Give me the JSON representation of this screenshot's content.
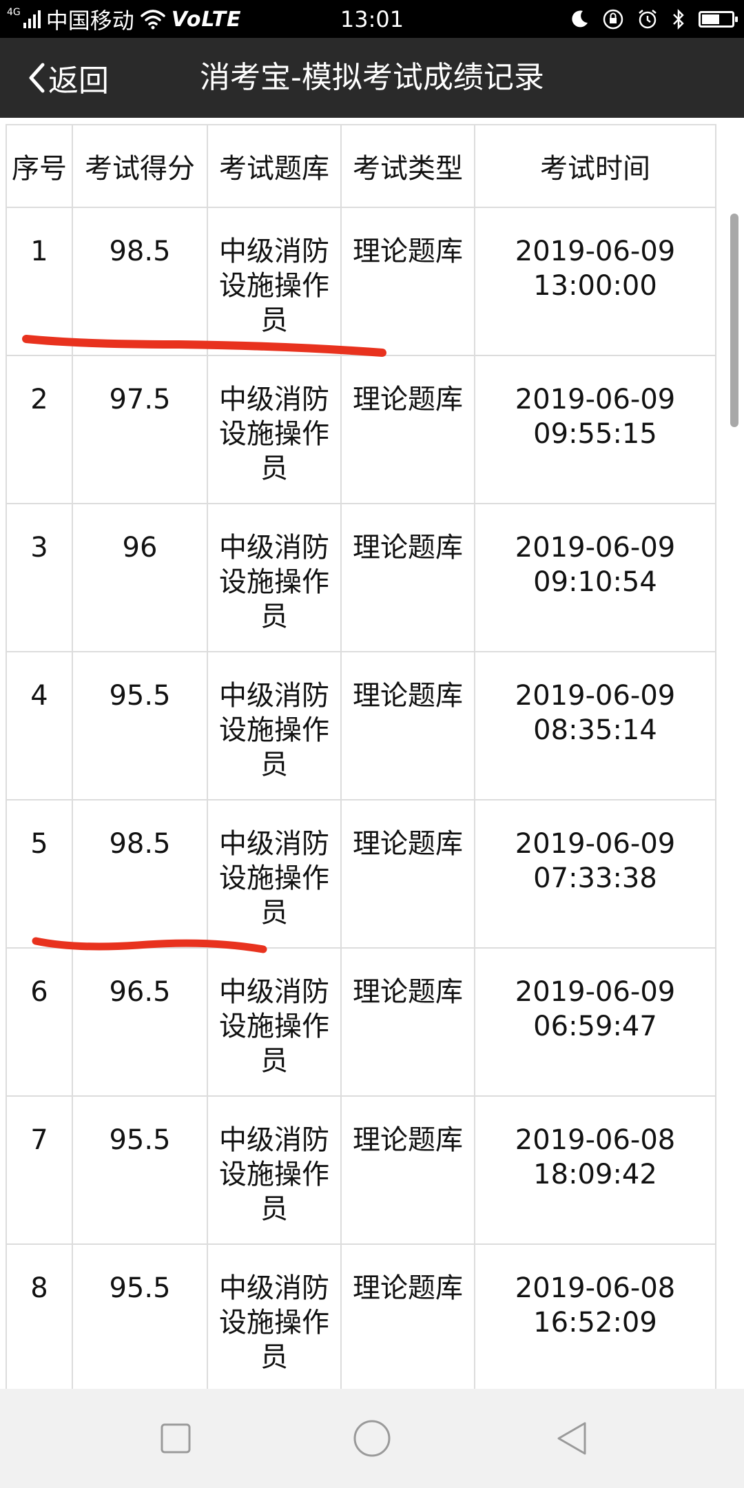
{
  "status_bar": {
    "network_type": "4G",
    "carrier": "中国移动",
    "volte": "VoLTE",
    "time": "13:01",
    "icons": [
      "moon-icon",
      "lock-rotation-icon",
      "alarm-icon",
      "bluetooth-icon",
      "battery-icon"
    ],
    "battery_level": 0.55
  },
  "header": {
    "back_label": "返回",
    "title": "消考宝-模拟考试成绩记录",
    "background": "#2a2a2a"
  },
  "table": {
    "columns": [
      "序号",
      "考试得分",
      "考试题库",
      "考试类型",
      "考试时间"
    ],
    "rows": [
      {
        "index": "1",
        "score": "98.5",
        "bank": "中级消防设施操作员",
        "type": "理论题库",
        "date": "2019-06-09",
        "clock": "13:00:00"
      },
      {
        "index": "2",
        "score": "97.5",
        "bank": "中级消防设施操作员",
        "type": "理论题库",
        "date": "2019-06-09",
        "clock": "09:55:15"
      },
      {
        "index": "3",
        "score": "96",
        "bank": "中级消防设施操作员",
        "type": "理论题库",
        "date": "2019-06-09",
        "clock": "09:10:54"
      },
      {
        "index": "4",
        "score": "95.5",
        "bank": "中级消防设施操作员",
        "type": "理论题库",
        "date": "2019-06-09",
        "clock": "08:35:14"
      },
      {
        "index": "5",
        "score": "98.5",
        "bank": "中级消防设施操作员",
        "type": "理论题库",
        "date": "2019-06-09",
        "clock": "07:33:38"
      },
      {
        "index": "6",
        "score": "96.5",
        "bank": "中级消防设施操作员",
        "type": "理论题库",
        "date": "2019-06-09",
        "clock": "06:59:47"
      },
      {
        "index": "7",
        "score": "95.5",
        "bank": "中级消防设施操作员",
        "type": "理论题库",
        "date": "2019-06-08",
        "clock": "18:09:42"
      },
      {
        "index": "8",
        "score": "95.5",
        "bank": "中级消防设施操作员",
        "type": "理论题库",
        "date": "2019-06-08",
        "clock": "16:52:09"
      }
    ]
  },
  "annotation_color": "#e8321e",
  "nav_bar": {
    "icons": [
      "recent-apps-icon",
      "home-icon",
      "back-triangle-icon"
    ]
  }
}
